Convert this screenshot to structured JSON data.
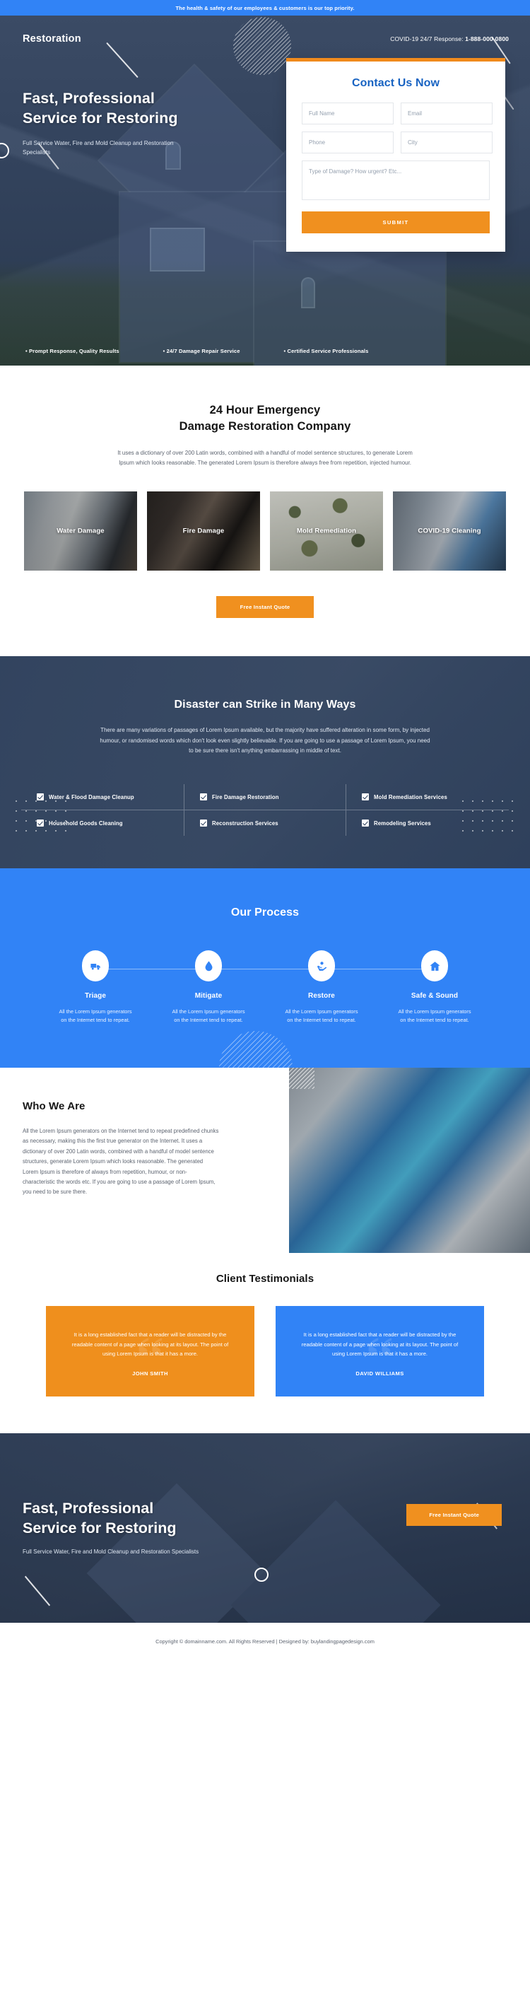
{
  "announcement": {
    "text": "The health & safety of our employees & customers is our top priority."
  },
  "hero": {
    "brand": "Restoration",
    "covid_label": "COVID-19 24/7 Response: ",
    "covid_phone": "1-888-000-0800",
    "heading_line1": "Fast, Professional",
    "heading_line2": "Service for Restoring",
    "subheading": "Full Service Water, Fire and Mold Cleanup and Restoration Specialists",
    "features": [
      "• Prompt Response, Quality Results",
      "• 24/7 Damage Repair Service",
      "• Certified Service Professionals"
    ]
  },
  "form": {
    "title": "Contact Us Now",
    "fields": [
      {
        "name": "full-name",
        "placeholder": "Full Name",
        "value": ""
      },
      {
        "name": "email",
        "placeholder": "Email",
        "value": ""
      },
      {
        "name": "phone",
        "placeholder": "Phone",
        "value": ""
      },
      {
        "name": "city",
        "placeholder": "City",
        "value": ""
      }
    ],
    "message_placeholder": "Type of Damage? How urgent? Etc...",
    "submit_label": "SUBMIT"
  },
  "emergency": {
    "heading_line1": "24 Hour Emergency",
    "heading_line2": "Damage Restoration Company",
    "paragraph": "It uses a dictionary of over 200 Latin words, combined with a handful of model sentence structures, to generate Lorem Ipsum which looks reasonable. The generated Lorem Ipsum is therefore always free from repetition, injected humour.",
    "cards": [
      {
        "label": "Water Damage"
      },
      {
        "label": "Fire Damage"
      },
      {
        "label": "Mold Remediation"
      },
      {
        "label": "COVID-19 Cleaning"
      }
    ],
    "cta_label": "Free Instant Quote"
  },
  "disaster": {
    "heading": "Disaster can Strike in Many Ways",
    "paragraph": "There are many variations of passages of Lorem Ipsum available, but the majority have suffered alteration in some form, by injected humour, or randomised words which don't look even slightly believable. If you are going to use a passage of Lorem Ipsum, you need to be sure there isn't anything embarrassing in middle of text.",
    "items": [
      "Water & Flood Damage Cleanup",
      "Fire Damage Restoration",
      "Mold Remediation Services",
      "Household Goods Cleaning",
      "Reconstruction Services",
      "Remodeling Services"
    ]
  },
  "process": {
    "heading": "Our Process",
    "steps": [
      {
        "icon": "truck-icon",
        "name": "Triage",
        "desc": "All the Lorem Ipsum generators on the Internet tend to repeat."
      },
      {
        "icon": "water-drop-icon",
        "name": "Mitigate",
        "desc": "All the Lorem Ipsum generators on the Internet tend to repeat."
      },
      {
        "icon": "hands-plant-icon",
        "name": "Restore",
        "desc": "All the Lorem Ipsum generators on the Internet tend to repeat."
      },
      {
        "icon": "home-icon",
        "name": "Safe & Sound",
        "desc": "All the Lorem Ipsum generators on the Internet tend to repeat."
      }
    ]
  },
  "who": {
    "heading": "Who We Are",
    "paragraph": "All the Lorem Ipsum generators on the Internet tend to repeat predefined chunks as necessary, making this the first true generator on the Internet. It uses a dictionary of over 200 Latin words, combined with a handful of model sentence structures, generate Lorem Ipsum which looks reasonable. The generated Lorem Ipsum is therefore of always from repetition, humour, or non-characteristic the words etc. If you are going to use a passage of Lorem Ipsum, you need to be sure there."
  },
  "testimonials": {
    "heading": "Client Testimonials",
    "items": [
      {
        "quote": "It is a long established fact that a reader will be distracted by the readable content of a page when looking at its layout. The point of using Lorem Ipsum is that it has a more.",
        "author": "JOHN SMITH",
        "color": "#ef8f1d"
      },
      {
        "quote": "It is a long established fact that a reader will be distracted by the readable content of a page when looking at its layout. The point of using Lorem Ipsum is that it has a more.",
        "author": "DAVID WILLIAMS",
        "color": "#3183f6"
      }
    ]
  },
  "cta": {
    "heading_line1": "Fast, Professional",
    "heading_line2": "Service for Restoring",
    "subheading": "Full Service Water, Fire and Mold Cleanup and Restoration Specialists",
    "button_label": "Free Instant Quote"
  },
  "footer": {
    "text": "Copyright © domainname.com. All Rights Reserved | Designed by: buylandingpagedesign.com"
  },
  "colors": {
    "accent_orange": "#f0901f",
    "accent_blue": "#3183f6",
    "dark_navy": "#2c3e5a"
  }
}
